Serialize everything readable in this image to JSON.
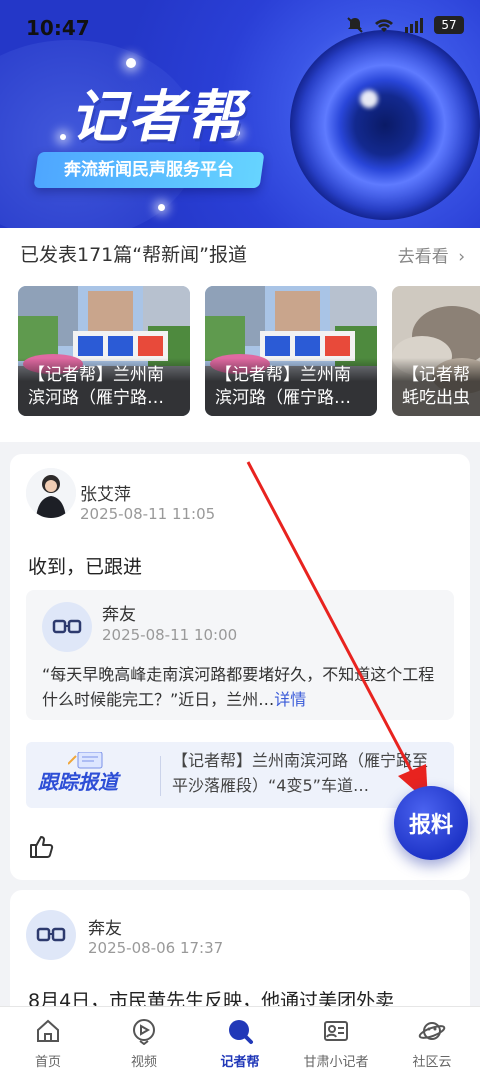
{
  "status_bar": {
    "time": "10:47",
    "battery": "57"
  },
  "banner": {
    "title": "记者帮",
    "slogan": "奔流新闻民声服务平台"
  },
  "published": {
    "summary": "已发表171篇“帮新闻”报道",
    "more_label": "去看看",
    "more_icon": "chevron-right-icon"
  },
  "featured_cards": [
    {
      "line1": "【记者帮】兰州南",
      "line2": "滨河路（雁宁路…"
    },
    {
      "line1": "【记者帮】兰州南",
      "line2": "滨河路（雁宁路…"
    },
    {
      "line1": "【记者帮",
      "line2": "蚝吃出虫"
    }
  ],
  "feed": [
    {
      "author": "张艾萍",
      "date": "2025-08-11 11:05",
      "comment": "收到，已跟进",
      "quote": {
        "author": "奔友",
        "date": "2025-08-11 10:00",
        "text": "“每天早晚高峰走南滨河路都要堵好久，不知道这个工程什么时候能完工？”近日，兰州…",
        "more": "详情"
      },
      "track": {
        "logo": "跟踪报道",
        "text": "【记者帮】兰州南滨河路（雁宁路至平沙落雁段）“4变5”车道…"
      }
    },
    {
      "author": "奔友",
      "date": "2025-08-06 17:37",
      "text": "8月4日，市民黄先生反映，他通过美团外卖"
    }
  ],
  "report_button": "报料",
  "bottom_nav": [
    {
      "label": "首页",
      "icon": "home-icon"
    },
    {
      "label": "视频",
      "icon": "video-icon"
    },
    {
      "label": "记者帮",
      "icon": "reporter-help-icon",
      "active": true
    },
    {
      "label": "甘肃小记者",
      "icon": "id-card-icon"
    },
    {
      "label": "社区云",
      "icon": "planet-icon"
    }
  ],
  "colors": {
    "accent": "#2138b8",
    "banner": "#2a3fd6",
    "arrow": "#e8231f"
  }
}
